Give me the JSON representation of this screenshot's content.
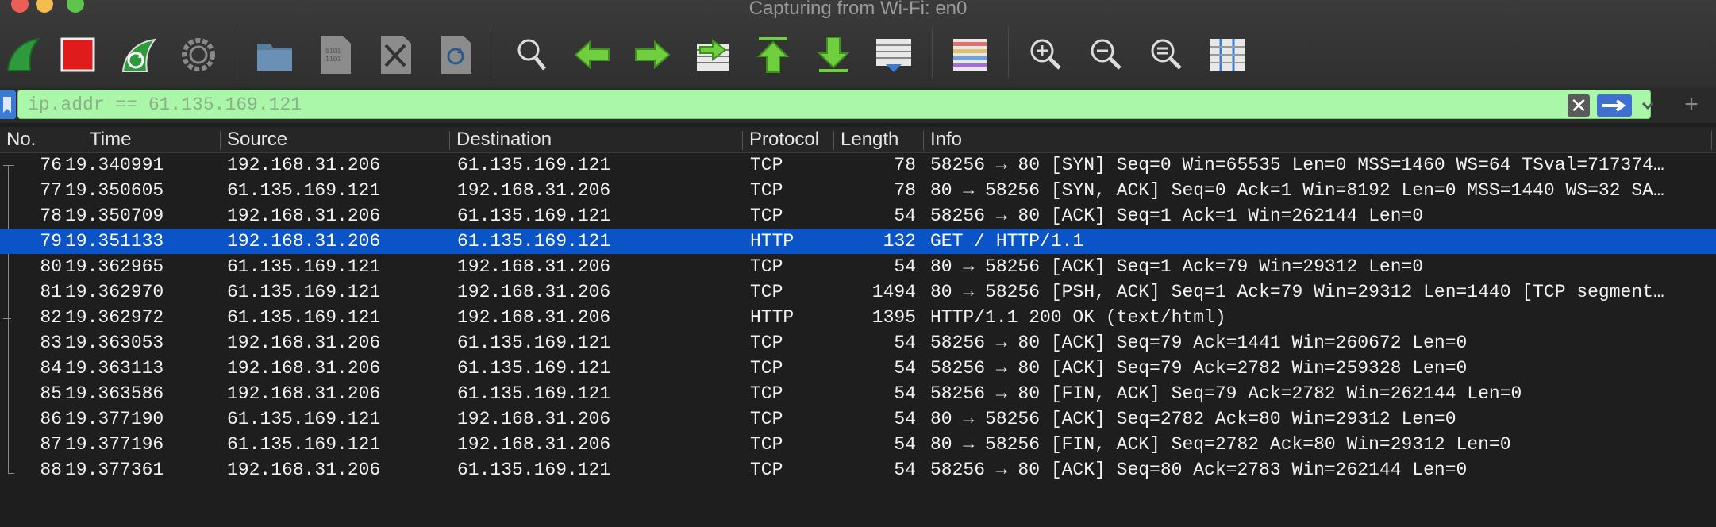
{
  "window": {
    "title": "Capturing from Wi-Fi: en0"
  },
  "toolbar": {
    "buttons": [
      {
        "name": "start-capture-icon"
      },
      {
        "name": "stop-capture-icon"
      },
      {
        "name": "restart-capture-icon"
      },
      {
        "name": "capture-options-icon"
      },
      {
        "name": "open-file-icon"
      },
      {
        "name": "save-file-icon"
      },
      {
        "name": "close-file-icon"
      },
      {
        "name": "reload-file-icon"
      },
      {
        "name": "find-packet-icon"
      },
      {
        "name": "go-back-icon"
      },
      {
        "name": "go-forward-icon"
      },
      {
        "name": "go-to-packet-icon"
      },
      {
        "name": "go-first-packet-icon"
      },
      {
        "name": "go-last-packet-icon"
      },
      {
        "name": "autoscroll-icon"
      },
      {
        "name": "colorize-icon"
      },
      {
        "name": "zoom-in-icon"
      },
      {
        "name": "zoom-out-icon"
      },
      {
        "name": "zoom-normal-icon"
      },
      {
        "name": "resize-columns-icon"
      }
    ]
  },
  "filter": {
    "value": "ip.addr == 61.135.169.121",
    "clear_label": "✕",
    "plus_label": "+"
  },
  "columns": {
    "no": "No.",
    "time": "Time",
    "source": "Source",
    "destination": "Destination",
    "protocol": "Protocol",
    "length": "Length",
    "info": "Info"
  },
  "packets": [
    {
      "no": "76",
      "time": "19.340991",
      "source": "192.168.31.206",
      "destination": "61.135.169.121",
      "protocol": "TCP",
      "length": "78",
      "info": "58256 → 80 [SYN] Seq=0 Win=65535 Len=0 MSS=1460 WS=64 TSval=717374…"
    },
    {
      "no": "77",
      "time": "19.350605",
      "source": "61.135.169.121",
      "destination": "192.168.31.206",
      "protocol": "TCP",
      "length": "78",
      "info": "80 → 58256 [SYN, ACK] Seq=0 Ack=1 Win=8192 Len=0 MSS=1440 WS=32 SA…"
    },
    {
      "no": "78",
      "time": "19.350709",
      "source": "192.168.31.206",
      "destination": "61.135.169.121",
      "protocol": "TCP",
      "length": "54",
      "info": "58256 → 80 [ACK] Seq=1 Ack=1 Win=262144 Len=0"
    },
    {
      "no": "79",
      "time": "19.351133",
      "source": "192.168.31.206",
      "destination": "61.135.169.121",
      "protocol": "HTTP",
      "length": "132",
      "info": "GET / HTTP/1.1",
      "selected": true
    },
    {
      "no": "80",
      "time": "19.362965",
      "source": "61.135.169.121",
      "destination": "192.168.31.206",
      "protocol": "TCP",
      "length": "54",
      "info": "80 → 58256 [ACK] Seq=1 Ack=79 Win=29312 Len=0"
    },
    {
      "no": "81",
      "time": "19.362970",
      "source": "61.135.169.121",
      "destination": "192.168.31.206",
      "protocol": "TCP",
      "length": "1494",
      "info": "80 → 58256 [PSH, ACK] Seq=1 Ack=79 Win=29312 Len=1440 [TCP segment…"
    },
    {
      "no": "82",
      "time": "19.362972",
      "source": "61.135.169.121",
      "destination": "192.168.31.206",
      "protocol": "HTTP",
      "length": "1395",
      "info": "HTTP/1.1 200 OK  (text/html)"
    },
    {
      "no": "83",
      "time": "19.363053",
      "source": "192.168.31.206",
      "destination": "61.135.169.121",
      "protocol": "TCP",
      "length": "54",
      "info": "58256 → 80 [ACK] Seq=79 Ack=1441 Win=260672 Len=0"
    },
    {
      "no": "84",
      "time": "19.363113",
      "source": "192.168.31.206",
      "destination": "61.135.169.121",
      "protocol": "TCP",
      "length": "54",
      "info": "58256 → 80 [ACK] Seq=79 Ack=2782 Win=259328 Len=0"
    },
    {
      "no": "85",
      "time": "19.363586",
      "source": "192.168.31.206",
      "destination": "61.135.169.121",
      "protocol": "TCP",
      "length": "54",
      "info": "58256 → 80 [FIN, ACK] Seq=79 Ack=2782 Win=262144 Len=0"
    },
    {
      "no": "86",
      "time": "19.377190",
      "source": "61.135.169.121",
      "destination": "192.168.31.206",
      "protocol": "TCP",
      "length": "54",
      "info": "80 → 58256 [ACK] Seq=2782 Ack=80 Win=29312 Len=0"
    },
    {
      "no": "87",
      "time": "19.377196",
      "source": "61.135.169.121",
      "destination": "192.168.31.206",
      "protocol": "TCP",
      "length": "54",
      "info": "80 → 58256 [FIN, ACK] Seq=2782 Ack=80 Win=29312 Len=0"
    },
    {
      "no": "88",
      "time": "19.377361",
      "source": "192.168.31.206",
      "destination": "61.135.169.121",
      "protocol": "TCP",
      "length": "54",
      "info": "58256 → 80 [ACK] Seq=80 Ack=2783 Win=262144 Len=0"
    }
  ],
  "colors": {
    "filter_valid": "#abf7a9",
    "selected_row": "#0a54c8",
    "stop_red": "#e01b1b",
    "start_green": "#2f9a3b"
  }
}
